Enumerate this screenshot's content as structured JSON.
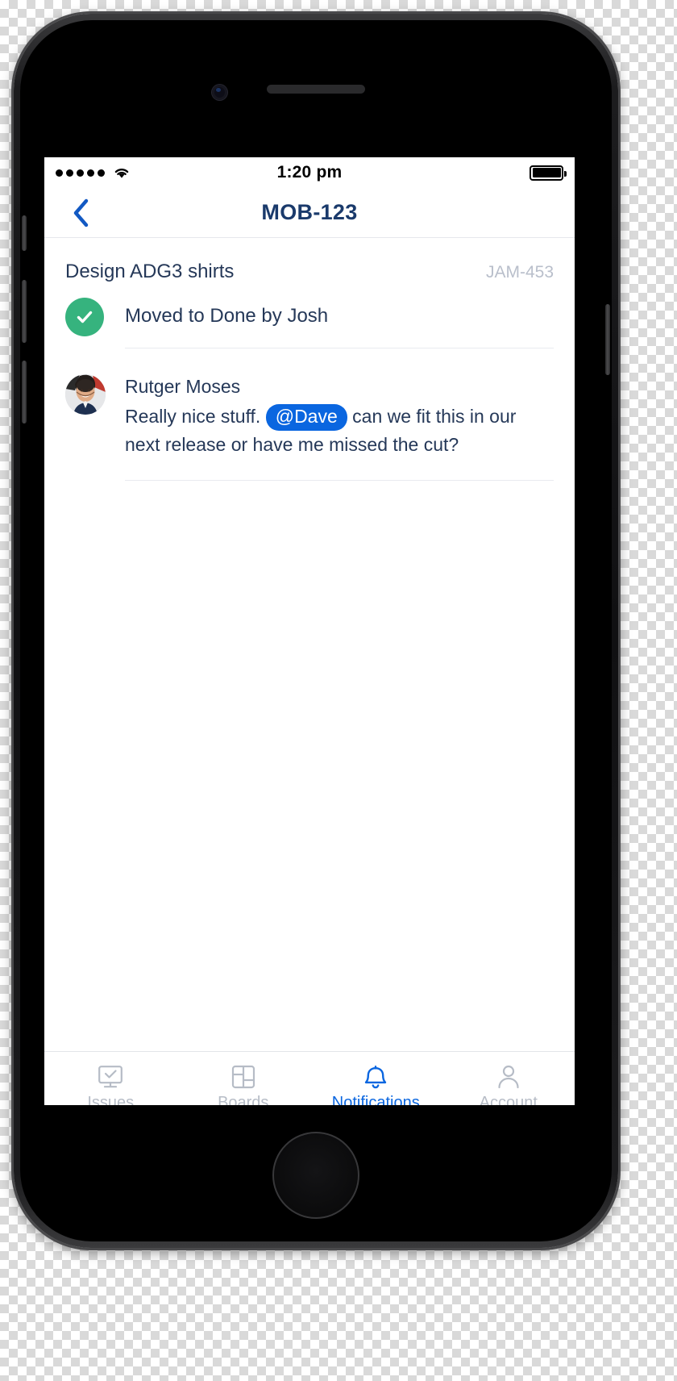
{
  "status_bar": {
    "signal_dots": 5,
    "signal_icon": "signal-dots-icon",
    "wifi_icon": "wifi-icon",
    "time": "1:20 pm",
    "battery_icon": "battery-full-icon",
    "battery_level_percent": 100
  },
  "nav": {
    "back_icon": "chevron-left-icon",
    "title": "MOB-123"
  },
  "issue": {
    "title": "Design ADG3 shirts",
    "key": "JAM-453"
  },
  "activity": [
    {
      "type": "status-change",
      "icon": "check-circle-icon",
      "icon_color": "#36b37e",
      "text": "Moved to Done by Josh"
    },
    {
      "type": "comment",
      "avatar": "user-avatar-photo",
      "author": "Rutger Moses",
      "text_before": "Really nice stuff.",
      "mention": "@Dave",
      "text_after": "can we fit this in our next release or have me missed the cut?"
    }
  ],
  "tabs": [
    {
      "id": "issues",
      "label": "Issues",
      "icon": "issues-monitor-check-icon",
      "active": false
    },
    {
      "id": "boards",
      "label": "Boards",
      "icon": "boards-grid-icon",
      "active": false
    },
    {
      "id": "notifications",
      "label": "Notifications",
      "icon": "bell-icon",
      "active": true
    },
    {
      "id": "account",
      "label": "Account",
      "icon": "person-icon",
      "active": false
    }
  ],
  "colors": {
    "accent": "#0a66e0",
    "text_primary": "#253858",
    "text_muted": "#b9bfcb",
    "success": "#36b37e",
    "nav_title": "#1a3a6b"
  }
}
